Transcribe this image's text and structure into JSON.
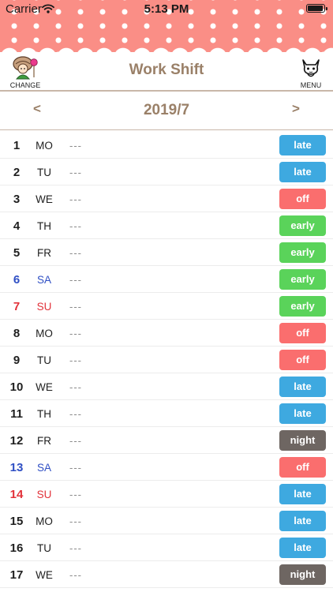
{
  "status_bar": {
    "carrier": "Carrier",
    "time": "5:13 PM"
  },
  "header": {
    "title": "Work Shift",
    "change_label": "CHANGE",
    "menu_label": "MENU"
  },
  "month_nav": {
    "prev": "<",
    "month": "2019/7",
    "next": ">"
  },
  "shift_colors": {
    "late": "#3ea9e0",
    "off": "#fa6e6e",
    "early": "#5ad35a",
    "night": "#6e6662"
  },
  "weekday_colors": {
    "SA": "#2f4fc4",
    "SU": "#e2323a",
    "default": "#1f1f1f"
  },
  "shifts": [
    {
      "day": "1",
      "weekday": "MO",
      "note": "---",
      "shift": "late"
    },
    {
      "day": "2",
      "weekday": "TU",
      "note": "---",
      "shift": "late"
    },
    {
      "day": "3",
      "weekday": "WE",
      "note": "---",
      "shift": "off"
    },
    {
      "day": "4",
      "weekday": "TH",
      "note": "---",
      "shift": "early"
    },
    {
      "day": "5",
      "weekday": "FR",
      "note": "---",
      "shift": "early"
    },
    {
      "day": "6",
      "weekday": "SA",
      "note": "---",
      "shift": "early"
    },
    {
      "day": "7",
      "weekday": "SU",
      "note": "---",
      "shift": "early"
    },
    {
      "day": "8",
      "weekday": "MO",
      "note": "---",
      "shift": "off"
    },
    {
      "day": "9",
      "weekday": "TU",
      "note": "---",
      "shift": "off"
    },
    {
      "day": "10",
      "weekday": "WE",
      "note": "---",
      "shift": "late"
    },
    {
      "day": "11",
      "weekday": "TH",
      "note": "---",
      "shift": "late"
    },
    {
      "day": "12",
      "weekday": "FR",
      "note": "---",
      "shift": "night"
    },
    {
      "day": "13",
      "weekday": "SA",
      "note": "---",
      "shift": "off"
    },
    {
      "day": "14",
      "weekday": "SU",
      "note": "---",
      "shift": "late"
    },
    {
      "day": "15",
      "weekday": "MO",
      "note": "---",
      "shift": "late"
    },
    {
      "day": "16",
      "weekday": "TU",
      "note": "---",
      "shift": "late"
    },
    {
      "day": "17",
      "weekday": "WE",
      "note": "---",
      "shift": "night"
    }
  ]
}
